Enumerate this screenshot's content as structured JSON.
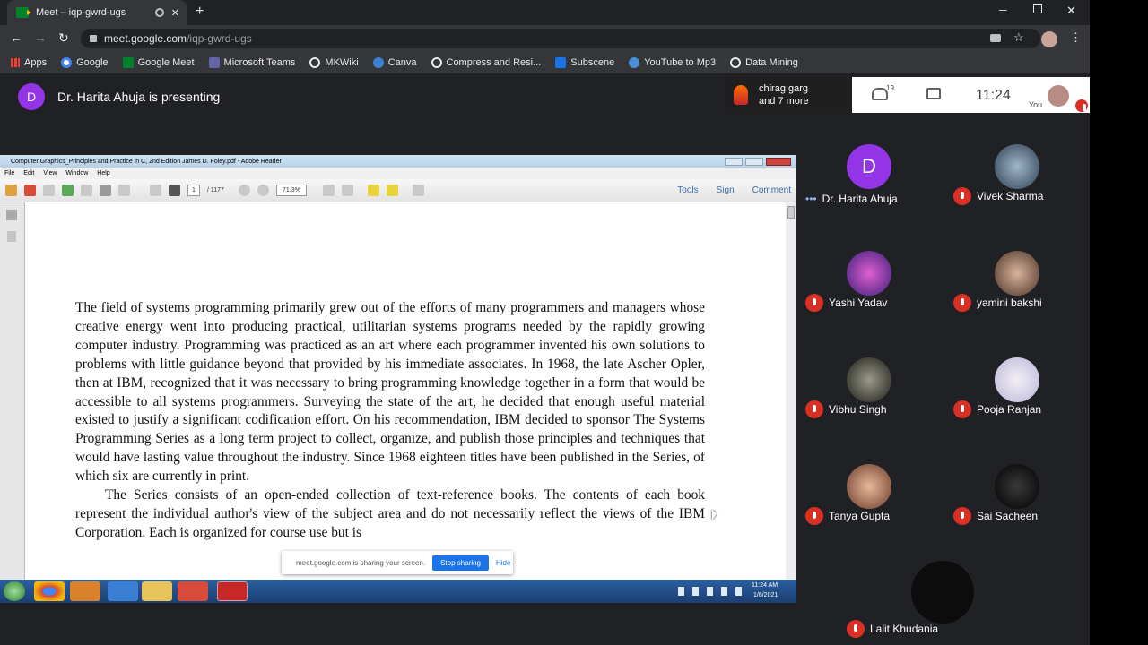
{
  "browser": {
    "tab_title": "Meet – iqp-gwrd-ugs",
    "url_host": "meet.google.com",
    "url_path": "/iqp-gwrd-ugs",
    "bookmarks": [
      "Apps",
      "Google",
      "Google Meet",
      "Microsoft Teams",
      "MKWiki",
      "Canva",
      "Compress and Resi...",
      "Subscene",
      "YouTube to Mp3",
      "Data Mining"
    ]
  },
  "meet": {
    "presenter_initial": "D",
    "presenter_text": "Dr. Harita Ahuja is presenting",
    "chat_name": "chirag garg",
    "chat_more": "and 7 more",
    "participant_count": "19",
    "time": "11:24",
    "you_label": "You",
    "participants": [
      {
        "name": "Dr. Harita Ahuja",
        "initial": "D"
      },
      {
        "name": "Vivek Sharma"
      },
      {
        "name": "Yashi Yadav"
      },
      {
        "name": "yamini bakshi"
      },
      {
        "name": "Vibhu Singh"
      },
      {
        "name": "Pooja Ranjan"
      },
      {
        "name": "Tanya Gupta"
      },
      {
        "name": "Sai Sacheen"
      },
      {
        "name": "Lalit Khudania"
      }
    ]
  },
  "adobe": {
    "window_title": "Computer Graphics_Principles and Practice in C, 2nd Edition James D. Foley.pdf - Adobe Reader",
    "menu": [
      "File",
      "Edit",
      "View",
      "Window",
      "Help"
    ],
    "page_current": "1",
    "page_total": "/ 1177",
    "zoom": "71.3%",
    "tools": "Tools",
    "sign": "Sign",
    "comment": "Comment",
    "para1": "The field of systems programming primarily grew out of the efforts of many programmers and managers whose creative energy went into producing practical, utilitarian systems programs needed by the rapidly growing computer industry. Programming was practiced as an art where each programmer invented his own solutions to problems with little guidance beyond that provided by his immediate associates. In 1968, the late Ascher Opler, then at IBM, recognized that it was necessary to bring programming knowledge together in a form that would be accessible to all systems programmers. Surveying the state of the art, he decided that enough useful material existed to justify a significant codification effort. On his recommendation, IBM decided to sponsor The Systems Programming Series as a long term project to collect, organize, and publish those principles and techniques that would have lasting value throughout the industry. Since 1968 eighteen titles have been published in the Series, of which six are currently in print.",
    "para2": "The Series consists of an open-ended collection of text-reference books. The contents of each book represent the individual author's view of the subject area and do not necessarily reflect the views of the IBM Corporation. Each is organized for course use but is",
    "share_text": "meet.google.com is sharing your screen.",
    "stop_sharing": "Stop sharing",
    "hide": "Hide",
    "tray_time": "11:24 AM",
    "tray_date": "1/6/2021"
  }
}
